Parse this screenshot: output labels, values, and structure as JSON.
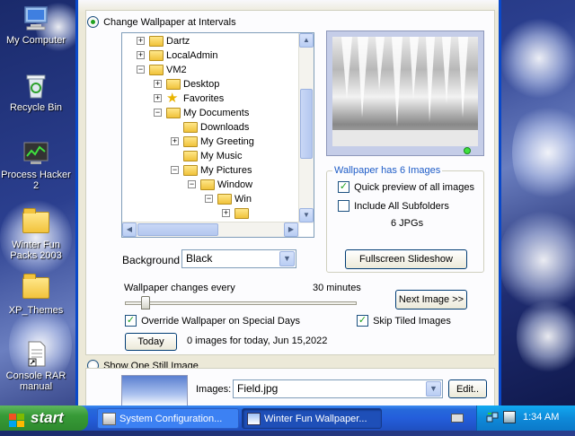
{
  "desktop": {
    "icons": [
      {
        "label": "My Computer",
        "icon": "computer-icon"
      },
      {
        "label": "Recycle Bin",
        "icon": "recycle-bin-icon"
      },
      {
        "label": "Process Hacker 2",
        "icon": "process-hacker-icon"
      },
      {
        "label": "Winter Fun Packs 2003",
        "icon": "folder-icon"
      },
      {
        "label": "XP_Themes",
        "icon": "folder-icon"
      },
      {
        "label": "Console RAR manual",
        "icon": "document-shortcut-icon"
      }
    ]
  },
  "window": {
    "intervals_label": "Change Wallpaper at Intervals",
    "tree": {
      "items": [
        {
          "label": "Dartz",
          "expander": "+"
        },
        {
          "label": "LocalAdmin",
          "expander": "+"
        },
        {
          "label": "VM2",
          "expander": "−"
        },
        {
          "label": "Desktop",
          "expander": "+"
        },
        {
          "label": "Favorites",
          "expander": "+"
        },
        {
          "label": "My Documents",
          "expander": "−"
        },
        {
          "label": "Downloads",
          "expander": ""
        },
        {
          "label": "My Greeting",
          "expander": "+"
        },
        {
          "label": "My Music",
          "expander": ""
        },
        {
          "label": "My Pictures",
          "expander": "−"
        },
        {
          "label": "Window",
          "expander": "−"
        },
        {
          "label": "Win",
          "expander": "−"
        },
        {
          "label": "",
          "expander": "+"
        }
      ]
    },
    "preview_group_label": "Wallpaper has 6 Images",
    "quick_preview_label": "Quick preview of all images",
    "include_subfolders_label": "Include All Subfolders",
    "file_count": "6 JPGs",
    "fullscreen_label": "Fullscreen Slideshow",
    "background_label": "Background",
    "background_value": "Black",
    "changes_every_label": "Wallpaper changes every",
    "interval_value": "30 minutes",
    "next_image_label": "Next Image >>",
    "override_label": "Override Wallpaper on Special Days",
    "skip_tiled_label": "Skip Tiled Images",
    "today_label": "Today",
    "today_info": "0 images for today, Jun 15,2022",
    "still_image_label": "Show One Still Image",
    "images_label": "Images:",
    "images_value": "Field.jpg",
    "edit_label": "Edit..",
    "quick_preview_checked": true,
    "include_subfolders_checked": false,
    "override_checked": true,
    "skip_tiled_checked": true,
    "interval_slider_fraction": 0.07
  },
  "taskbar": {
    "start_label": "start",
    "tasks": [
      {
        "label": "System Configuration...",
        "icon": "system-config-icon"
      },
      {
        "label": "Winter Fun Wallpaper...",
        "icon": "wallpaper-app-icon"
      }
    ],
    "clock": "1:34 AM"
  }
}
